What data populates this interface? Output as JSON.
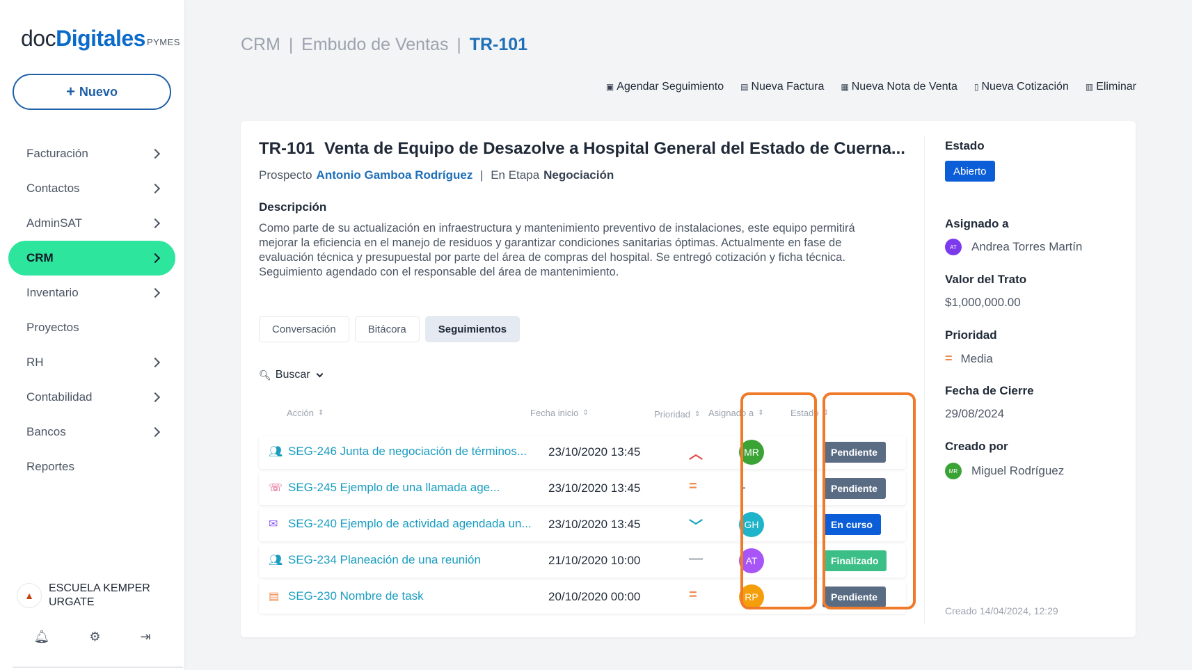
{
  "brand": {
    "part1": "doc",
    "part2": "Digitales",
    "part3": "PYMES"
  },
  "sidebar": {
    "new_label": "Nuevo",
    "items": [
      {
        "label": "Facturación",
        "chevron": true,
        "active": false
      },
      {
        "label": "Contactos",
        "chevron": true,
        "active": false
      },
      {
        "label": "AdminSAT",
        "chevron": true,
        "active": false
      },
      {
        "label": "CRM",
        "chevron": true,
        "active": true
      },
      {
        "label": "Inventario",
        "chevron": true,
        "active": false
      },
      {
        "label": "Proyectos",
        "chevron": false,
        "active": false
      },
      {
        "label": "RH",
        "chevron": true,
        "active": false
      },
      {
        "label": "Contabilidad",
        "chevron": true,
        "active": false
      },
      {
        "label": "Bancos",
        "chevron": true,
        "active": false
      },
      {
        "label": "Reportes",
        "chevron": false,
        "active": false
      }
    ],
    "org_line1": "ESCUELA KEMPER",
    "org_line2": "URGATE",
    "icons": [
      "bell-icon",
      "gear-icon",
      "logout-icon"
    ]
  },
  "breadcrumb": {
    "part1": "CRM",
    "part2": "Embudo de Ventas",
    "current": "TR-101"
  },
  "toolbar": {
    "schedule": "Agendar Seguimiento",
    "invoice": "Nueva Factura",
    "sale_note": "Nueva Nota de Venta",
    "quote": "Nueva Cotización",
    "delete": "Eliminar"
  },
  "deal": {
    "code": "TR-101",
    "title": "Venta de Equipo de Desazolve a Hospital General del Estado de Cuerna...",
    "prospect_label": "Prospecto",
    "prospect_name": "Antonio Gamboa Rodríguez",
    "stage_label": "En Etapa",
    "stage_name": "Negociación",
    "desc_label": "Descripción",
    "desc_text": "Como parte de su actualización en infraestructura y mantenimiento preventivo de instalaciones, este equipo permitirá mejorar la eficiencia en el manejo de residuos y garantizar condiciones sanitarias óptimas. Actualmente en fase de evaluación técnica y presupuestal por parte del área de compras del hospital. Se entregó cotización y ficha técnica. Seguimiento agendado con el responsable del área de mantenimiento."
  },
  "tabs": {
    "conversation": "Conversación",
    "log": "Bitácora",
    "followups": "Seguimientos"
  },
  "search_label": "Buscar",
  "table": {
    "headers": {
      "action": "Acción",
      "start": "Fecha inicio",
      "priority": "Prioridad",
      "assigned": "Asignado a",
      "status": "Estado"
    },
    "rows": [
      {
        "icon": "people-icon",
        "icon_color": "#1a9dc0",
        "name": "SEG-246 Junta de negociación de términos...",
        "date": "23/10/2020 13:45",
        "priority": "alta",
        "prio_glyph": "︿",
        "prio_color": "#e24a4a",
        "assignee": "MR",
        "assignee_color": "#3aa335",
        "status": "Pendiente",
        "status_color": "#5a6b84"
      },
      {
        "icon": "phone-icon",
        "icon_color": "#d6336c",
        "name": "SEG-245 Ejemplo de una llamada age...",
        "date": "23/10/2020 13:45",
        "priority": "media",
        "prio_glyph": "=",
        "prio_color": "#f08a4b",
        "assignee": "-",
        "assignee_color": "",
        "status": "Pendiente",
        "status_color": "#5a6b84"
      },
      {
        "icon": "mail-icon",
        "icon_color": "#8b5cf6",
        "name": "SEG-240 Ejemplo de actividad agendada un...",
        "date": "23/10/2020 13:45",
        "priority": "baja",
        "prio_glyph": "﹀",
        "prio_color": "#14a3b8",
        "assignee": "GH",
        "assignee_color": "#1fb4c9",
        "status": "En curso",
        "status_color": "#0b5ed7"
      },
      {
        "icon": "people-icon",
        "icon_color": "#1a9dc0",
        "name": "SEG-234 Planeación de una reunión",
        "date": "21/10/2020 10:00",
        "priority": "ninguna",
        "prio_glyph": "—",
        "prio_color": "#9ca3af",
        "assignee": "AT",
        "assignee_color": "#a855f7",
        "status": "Finalizado",
        "status_color": "#3cbf86"
      },
      {
        "icon": "note-icon",
        "icon_color": "#f08a4b",
        "name": "SEG-230 Nombre de task",
        "date": "20/10/2020 00:00",
        "priority": "media",
        "prio_glyph": "=",
        "prio_color": "#f08a4b",
        "assignee": "RP",
        "assignee_color": "#f59e0b",
        "status": "Pendiente",
        "status_color": "#5a6b84"
      }
    ]
  },
  "panel": {
    "status_label": "Estado",
    "status_value": "Abierto",
    "assigned_label": "Asignado a",
    "assigned_initials": "AT",
    "assigned_name": "Andrea Torres Martín",
    "value_label": "Valor del Trato",
    "value_amount": "$1,000,000.00",
    "priority_label": "Prioridad",
    "priority_value": "Media",
    "close_label": "Fecha de Cierre",
    "close_date": "29/08/2024",
    "created_by_label": "Creado por",
    "created_by_initials": "MR",
    "created_by_name": "Miguel Rodríguez",
    "created_at": "Creado 14/04/2024, 12:29"
  },
  "colors": {
    "accent": "#1e6fb8",
    "nav_active": "#2ee59d",
    "highlight": "#ef7b2a"
  }
}
